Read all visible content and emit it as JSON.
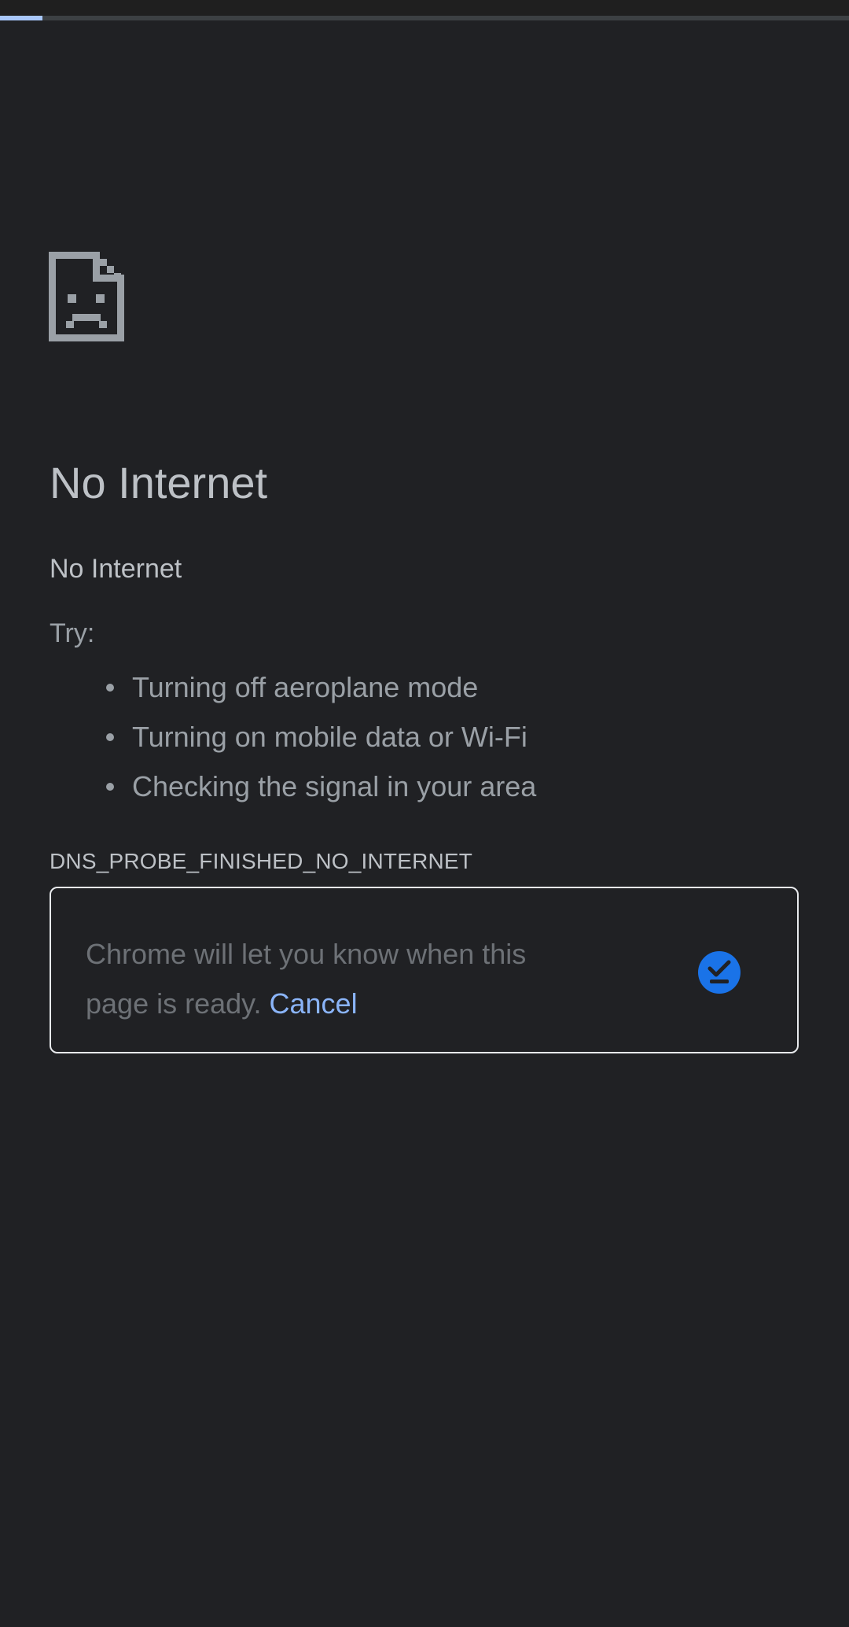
{
  "colors": {
    "background": "#202124",
    "progress_fill": "#a8c7fa",
    "progress_track": "#3c4043",
    "link": "#8ab4f8",
    "notify_icon_bg": "#1a73e8",
    "icon": "#9aa0a6"
  },
  "page_loading": {
    "progress_fraction": 0.05
  },
  "error_page": {
    "icon": "sad-document-icon",
    "heading": "No Internet",
    "subheading": "No Internet",
    "try_label": "Try:",
    "suggestions": [
      "Turning off aeroplane mode",
      "Turning on mobile data or Wi-Fi",
      "Checking the signal in your area"
    ],
    "error_code": "DNS_PROBE_FINISHED_NO_INTERNET"
  },
  "notification_box": {
    "message": "Chrome will let you know when this page is ready.",
    "cancel_label": "Cancel",
    "icon": "download-check-icon"
  }
}
